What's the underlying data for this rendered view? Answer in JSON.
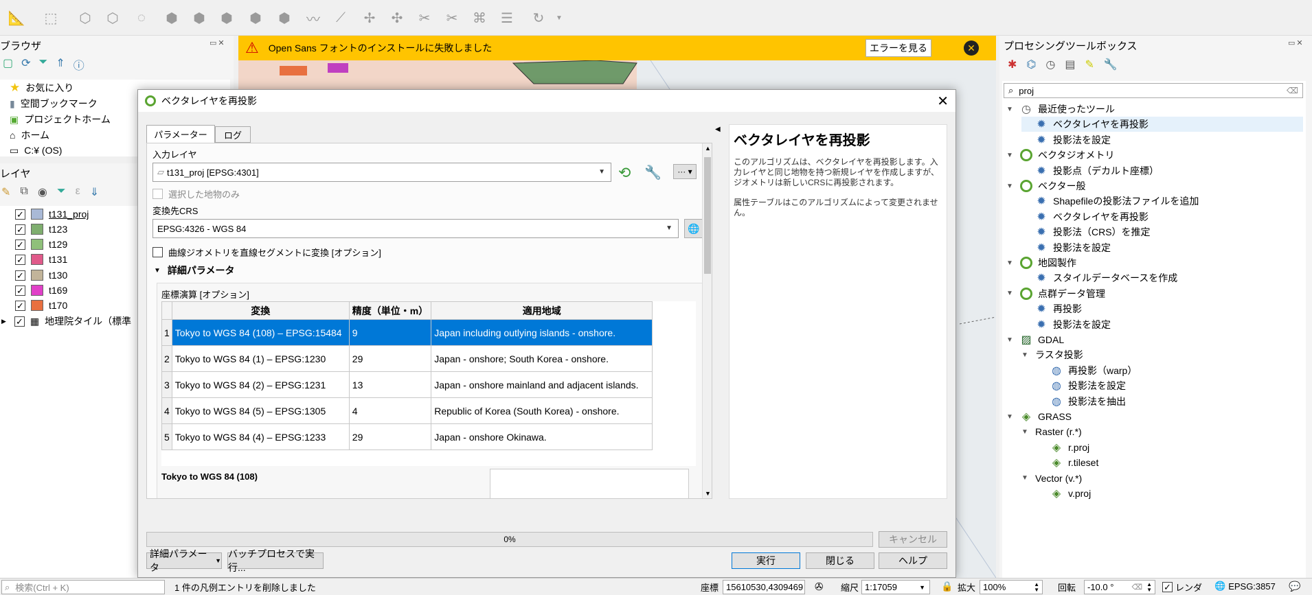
{
  "message_bar": {
    "text": "Open Sans フォントのインストールに失敗しました",
    "button": "エラーを見る"
  },
  "browser_panel": {
    "title": "ブラウザ",
    "items": [
      {
        "label": "お気に入り",
        "icon": "star-icon"
      },
      {
        "label": "空間ブックマーク",
        "icon": "bookmark-icon"
      },
      {
        "label": "プロジェクトホーム",
        "icon": "project-home-icon"
      },
      {
        "label": "ホーム",
        "icon": "home-icon"
      },
      {
        "label": "C:¥ (OS)",
        "icon": "folder-icon"
      }
    ]
  },
  "layers_panel": {
    "title": "レイヤ",
    "layers": [
      {
        "name": "t131_proj",
        "color": "#a9b9d6"
      },
      {
        "name": "t123",
        "color": "#7fae6f"
      },
      {
        "name": "t129",
        "color": "#8fc07a"
      },
      {
        "name": "t131",
        "color": "#e05a8a"
      },
      {
        "name": "t130",
        "color": "#c2b49a"
      },
      {
        "name": "t169",
        "color": "#e040c8"
      },
      {
        "name": "t170",
        "color": "#e87040"
      },
      {
        "name": "地理院タイル（標準",
        "color": ""
      }
    ]
  },
  "dialog": {
    "title": "ベクタレイヤを再投影",
    "tabs": [
      "パラメーター",
      "ログ"
    ],
    "input_layer_label": "入力レイヤ",
    "input_layer_value": "t131_proj [EPSG:4301]",
    "selected_only_label": "選択した地物のみ",
    "target_crs_label": "変換先CRS",
    "target_crs_value": "EPSG:4326 - WGS 84",
    "curve_label": "曲線ジオメトリを直線セグメントに変換 [オプション]",
    "advanced_label": "詳細パラメータ",
    "coord_op_label": "座標演算 [オプション]",
    "table_headers": [
      "変換",
      "精度（単位・m）",
      "適用地域"
    ],
    "rows": [
      {
        "n": "1",
        "transform": "Tokyo to WGS 84 (108) – EPSG:15484",
        "accuracy": "9",
        "area": "Japan including outlying islands - onshore."
      },
      {
        "n": "2",
        "transform": "Tokyo to WGS 84 (1) – EPSG:1230",
        "accuracy": "29",
        "area": "Japan - onshore; South Korea - onshore."
      },
      {
        "n": "3",
        "transform": "Tokyo to WGS 84 (2) – EPSG:1231",
        "accuracy": "13",
        "area": "Japan - onshore mainland and adjacent islands."
      },
      {
        "n": "4",
        "transform": "Tokyo to WGS 84 (5) – EPSG:1305",
        "accuracy": "4",
        "area": "Republic of Korea (South Korea) - onshore."
      },
      {
        "n": "5",
        "transform": "Tokyo to WGS 84 (4) – EPSG:1233",
        "accuracy": "29",
        "area": "Japan - onshore Okinawa."
      }
    ],
    "selected_detail": "Tokyo to WGS 84 (108)",
    "help_title": "ベクタレイヤを再投影",
    "help_p1": "このアルゴリズムは、ベクタレイヤを再投影します。入力レイヤと同じ地物を持つ新規レイヤを作成しますが、ジオメトリは新しいCRSに再投影されます。",
    "help_p2": "属性テーブルはこのアルゴリズムによって変更されません。",
    "progress": "0%",
    "progress_value": 0,
    "cancel": "キャンセル",
    "advanced_btn": "詳細パラメータ",
    "batch_btn": "バッチプロセスで実行...",
    "run": "実行",
    "close": "閉じる",
    "help": "ヘルプ"
  },
  "toolbox": {
    "title": "プロセシングツールボックス",
    "search_value": "proj",
    "tree": [
      {
        "label": "最近使ったツール",
        "level": 0,
        "icon": "clock-icon",
        "expander": "▼"
      },
      {
        "label": "ベクタレイヤを再投影",
        "level": 1,
        "icon": "gear-icon",
        "selected": true
      },
      {
        "label": "投影法を設定",
        "level": 1,
        "icon": "gear-icon"
      },
      {
        "label": "ベクタジオメトリ",
        "level": 0,
        "icon": "qgis-icon",
        "expander": "▼"
      },
      {
        "label": "投影点（デカルト座標）",
        "level": 1,
        "icon": "gear-icon"
      },
      {
        "label": "ベクター般",
        "level": 0,
        "icon": "qgis-icon",
        "expander": "▼"
      },
      {
        "label": "Shapefileの投影法ファイルを追加",
        "level": 1,
        "icon": "gear-icon"
      },
      {
        "label": "ベクタレイヤを再投影",
        "level": 1,
        "icon": "gear-icon"
      },
      {
        "label": "投影法（CRS）を推定",
        "level": 1,
        "icon": "gear-icon"
      },
      {
        "label": "投影法を設定",
        "level": 1,
        "icon": "gear-icon"
      },
      {
        "label": "地図製作",
        "level": 0,
        "icon": "qgis-icon",
        "expander": "▼"
      },
      {
        "label": "スタイルデータベースを作成",
        "level": 1,
        "icon": "gear-icon"
      },
      {
        "label": "点群データ管理",
        "level": 0,
        "icon": "qgis-icon",
        "expander": "▼"
      },
      {
        "label": "再投影",
        "level": 1,
        "icon": "gear-icon"
      },
      {
        "label": "投影法を設定",
        "level": 1,
        "icon": "gear-icon"
      },
      {
        "label": "GDAL",
        "level": 0,
        "icon": "gdal-icon",
        "expander": "▼"
      },
      {
        "label": "ラスタ投影",
        "level": 1,
        "icon": "",
        "expander": "▼"
      },
      {
        "label": "再投影（warp）",
        "level": 2,
        "icon": "globe-icon"
      },
      {
        "label": "投影法を設定",
        "level": 2,
        "icon": "globe-icon"
      },
      {
        "label": "投影法を抽出",
        "level": 2,
        "icon": "globe-icon"
      },
      {
        "label": "GRASS",
        "level": 0,
        "icon": "grass-icon",
        "expander": "▼"
      },
      {
        "label": "Raster (r.*)",
        "level": 1,
        "icon": "",
        "expander": "▼"
      },
      {
        "label": "r.proj",
        "level": 2,
        "icon": "grass-icon"
      },
      {
        "label": "r.tileset",
        "level": 2,
        "icon": "grass-icon"
      },
      {
        "label": "Vector (v.*)",
        "level": 1,
        "icon": "",
        "expander": "▼"
      },
      {
        "label": "v.proj",
        "level": 2,
        "icon": "grass-icon"
      }
    ]
  },
  "statusbar": {
    "search_placeholder": "検索(Ctrl + K)",
    "message": "1 件の凡例エントリを削除しました",
    "coord_label": "座標",
    "coord_value": "15610530,4309469",
    "scale_label": "縮尺",
    "scale_value": "1:17059",
    "zoom_label": "拡大",
    "zoom_value": "100%",
    "rotation_label": "回転",
    "rotation_value": "-10.0 °",
    "render_label": "レンダ",
    "crs": "EPSG:3857"
  }
}
